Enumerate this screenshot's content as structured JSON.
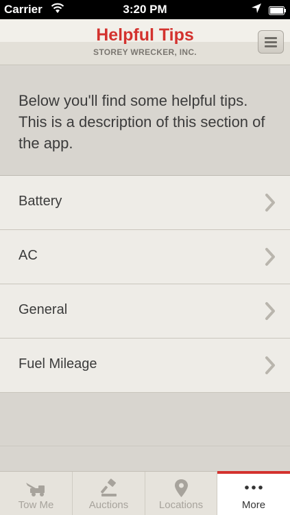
{
  "status_bar": {
    "carrier": "Carrier",
    "time": "3:20 PM"
  },
  "header": {
    "title": "Helpful Tips",
    "subtitle": "STOREY WRECKER, INC.",
    "menu_icon": "hamburger-icon"
  },
  "intro": {
    "text": "Below you'll find some helpful tips. This is a description of this section of the app."
  },
  "tips": [
    {
      "label": "Battery"
    },
    {
      "label": "AC"
    },
    {
      "label": "General"
    },
    {
      "label": "Fuel Mileage"
    }
  ],
  "tab_bar": {
    "tabs": [
      {
        "label": "Tow Me",
        "icon": "tow-truck-icon",
        "active": false
      },
      {
        "label": "Auctions",
        "icon": "gavel-icon",
        "active": false
      },
      {
        "label": "Locations",
        "icon": "map-pin-icon",
        "active": false
      },
      {
        "label": "More",
        "icon": "more-dots-icon",
        "active": true
      }
    ]
  },
  "colors": {
    "accent": "#d3322e",
    "background": "#d8d5cf",
    "list_background": "#eeece7"
  }
}
